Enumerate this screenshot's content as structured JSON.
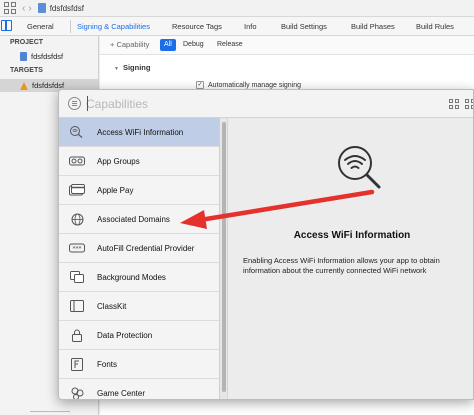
{
  "window": {
    "project_name": "fdsfdsfdsf"
  },
  "tabs": [
    {
      "label": "General"
    },
    {
      "label": "Signing & Capabilities"
    },
    {
      "label": "Resource Tags"
    },
    {
      "label": "Info"
    },
    {
      "label": "Build Settings"
    },
    {
      "label": "Build Phases"
    },
    {
      "label": "Build Rules"
    }
  ],
  "navigator": {
    "project_heading": "PROJECT",
    "project_item": "fdsfdsfdsf",
    "targets_heading": "TARGETS",
    "target_item": "fdsfdsfdsf"
  },
  "editor": {
    "add_capability": "+ Capability",
    "filters": [
      "All",
      "Debug",
      "Release"
    ],
    "signing_title": "Signing",
    "auto_manage_label": "Automatically manage signing",
    "auto_manage_checked": "✓"
  },
  "capabilities_popup": {
    "search_placeholder": "Capabilities",
    "items": [
      {
        "label": "Access WiFi Information",
        "icon": "wifi-magnifier-icon"
      },
      {
        "label": "App Groups",
        "icon": "app-groups-icon"
      },
      {
        "label": "Apple Pay",
        "icon": "credit-card-icon"
      },
      {
        "label": "Associated Domains",
        "icon": "globe-icon"
      },
      {
        "label": "AutoFill Credential Provider",
        "icon": "key-icon"
      },
      {
        "label": "Background Modes",
        "icon": "background-modes-icon"
      },
      {
        "label": "ClassKit",
        "icon": "classkit-icon"
      },
      {
        "label": "Data Protection",
        "icon": "lock-icon"
      },
      {
        "label": "Fonts",
        "icon": "font-icon"
      },
      {
        "label": "Game Center",
        "icon": "game-center-icon"
      }
    ],
    "selected_index": 0,
    "detail": {
      "title": "Access WiFi Information",
      "description": "Enabling Access WiFi Information allows your app to obtain information about the currently connected WiFi network"
    }
  },
  "annotation": {
    "arrow_color": "#e5312b"
  },
  "colors": {
    "accent": "#1a6ee8",
    "selection": "#bfcde6"
  }
}
